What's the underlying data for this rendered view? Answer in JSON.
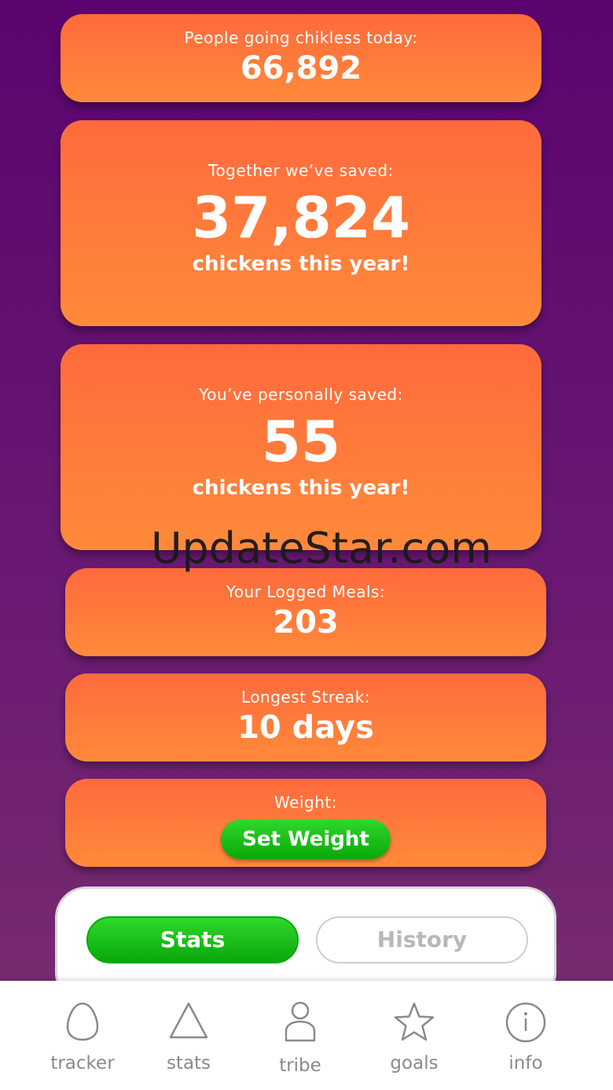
{
  "cards": {
    "people_today": {
      "label": "People going chikless today:",
      "value": "66,892"
    },
    "together_saved": {
      "label": "Together we’ve saved:",
      "value": "37,824",
      "sub": "chickens this year!"
    },
    "personal_saved": {
      "label": "You’ve personally saved:",
      "value": "55",
      "sub": "chickens this year!"
    },
    "logged_meals": {
      "label": "Your Logged Meals:",
      "value": "203"
    },
    "longest_streak": {
      "label": "Longest Streak:",
      "value": "10 days"
    },
    "weight": {
      "label": "Weight:",
      "button_label": "Set Weight"
    }
  },
  "segmented": {
    "stats_label": "Stats",
    "history_label": "History",
    "selected": "Stats"
  },
  "nav": {
    "items": [
      {
        "label": "tracker",
        "icon": "egg-icon"
      },
      {
        "label": "stats",
        "icon": "triangle-icon"
      },
      {
        "label": "tribe",
        "icon": "person-icon"
      },
      {
        "label": "goals",
        "icon": "star-icon"
      },
      {
        "label": "info",
        "icon": "info-icon"
      }
    ]
  },
  "watermark": "UpdateStar.com",
  "colors": {
    "background": "#5b046f",
    "card_orange": "#ff7a3a",
    "button_green": "#1fc81c",
    "nav_gray": "#8a8a8a"
  }
}
